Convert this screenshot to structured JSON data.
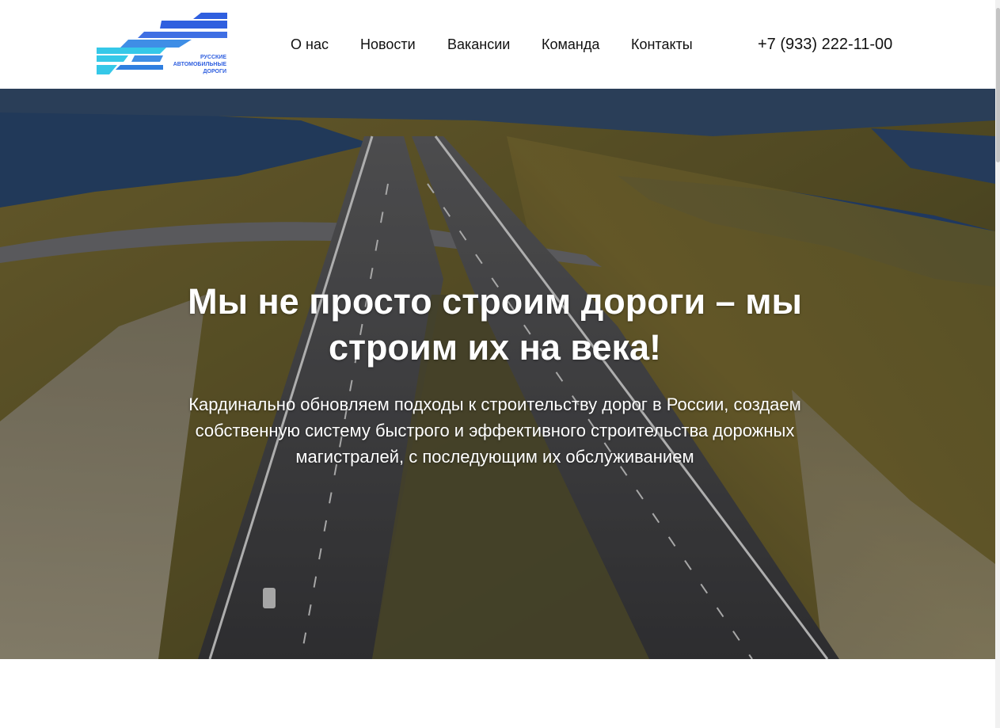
{
  "header": {
    "logo_text": [
      "РУССКИЕ",
      "АВТОМОБИЛЬНЫЕ",
      "ДОРОГИ"
    ],
    "nav": [
      {
        "label": "О нас"
      },
      {
        "label": "Новости"
      },
      {
        "label": "Вакансии"
      },
      {
        "label": "Команда"
      },
      {
        "label": "Контакты"
      }
    ],
    "phone": "+7 (933) 222-11-00"
  },
  "hero": {
    "title": "Мы не просто строим дороги – мы строим их на века!",
    "subtitle": "Кардинально обновляем подходы к строительству дорог в России, создаем собственную систему быстрого и эффективного строительства дорожных магистралей, с последующим их обслуживанием",
    "background": "aerial-highway-photo"
  },
  "colors": {
    "logo_dark_blue": "#2f5fdf",
    "logo_mid_blue": "#3f8ee6",
    "logo_cyan": "#35c8e8",
    "text_dark": "#111111"
  }
}
